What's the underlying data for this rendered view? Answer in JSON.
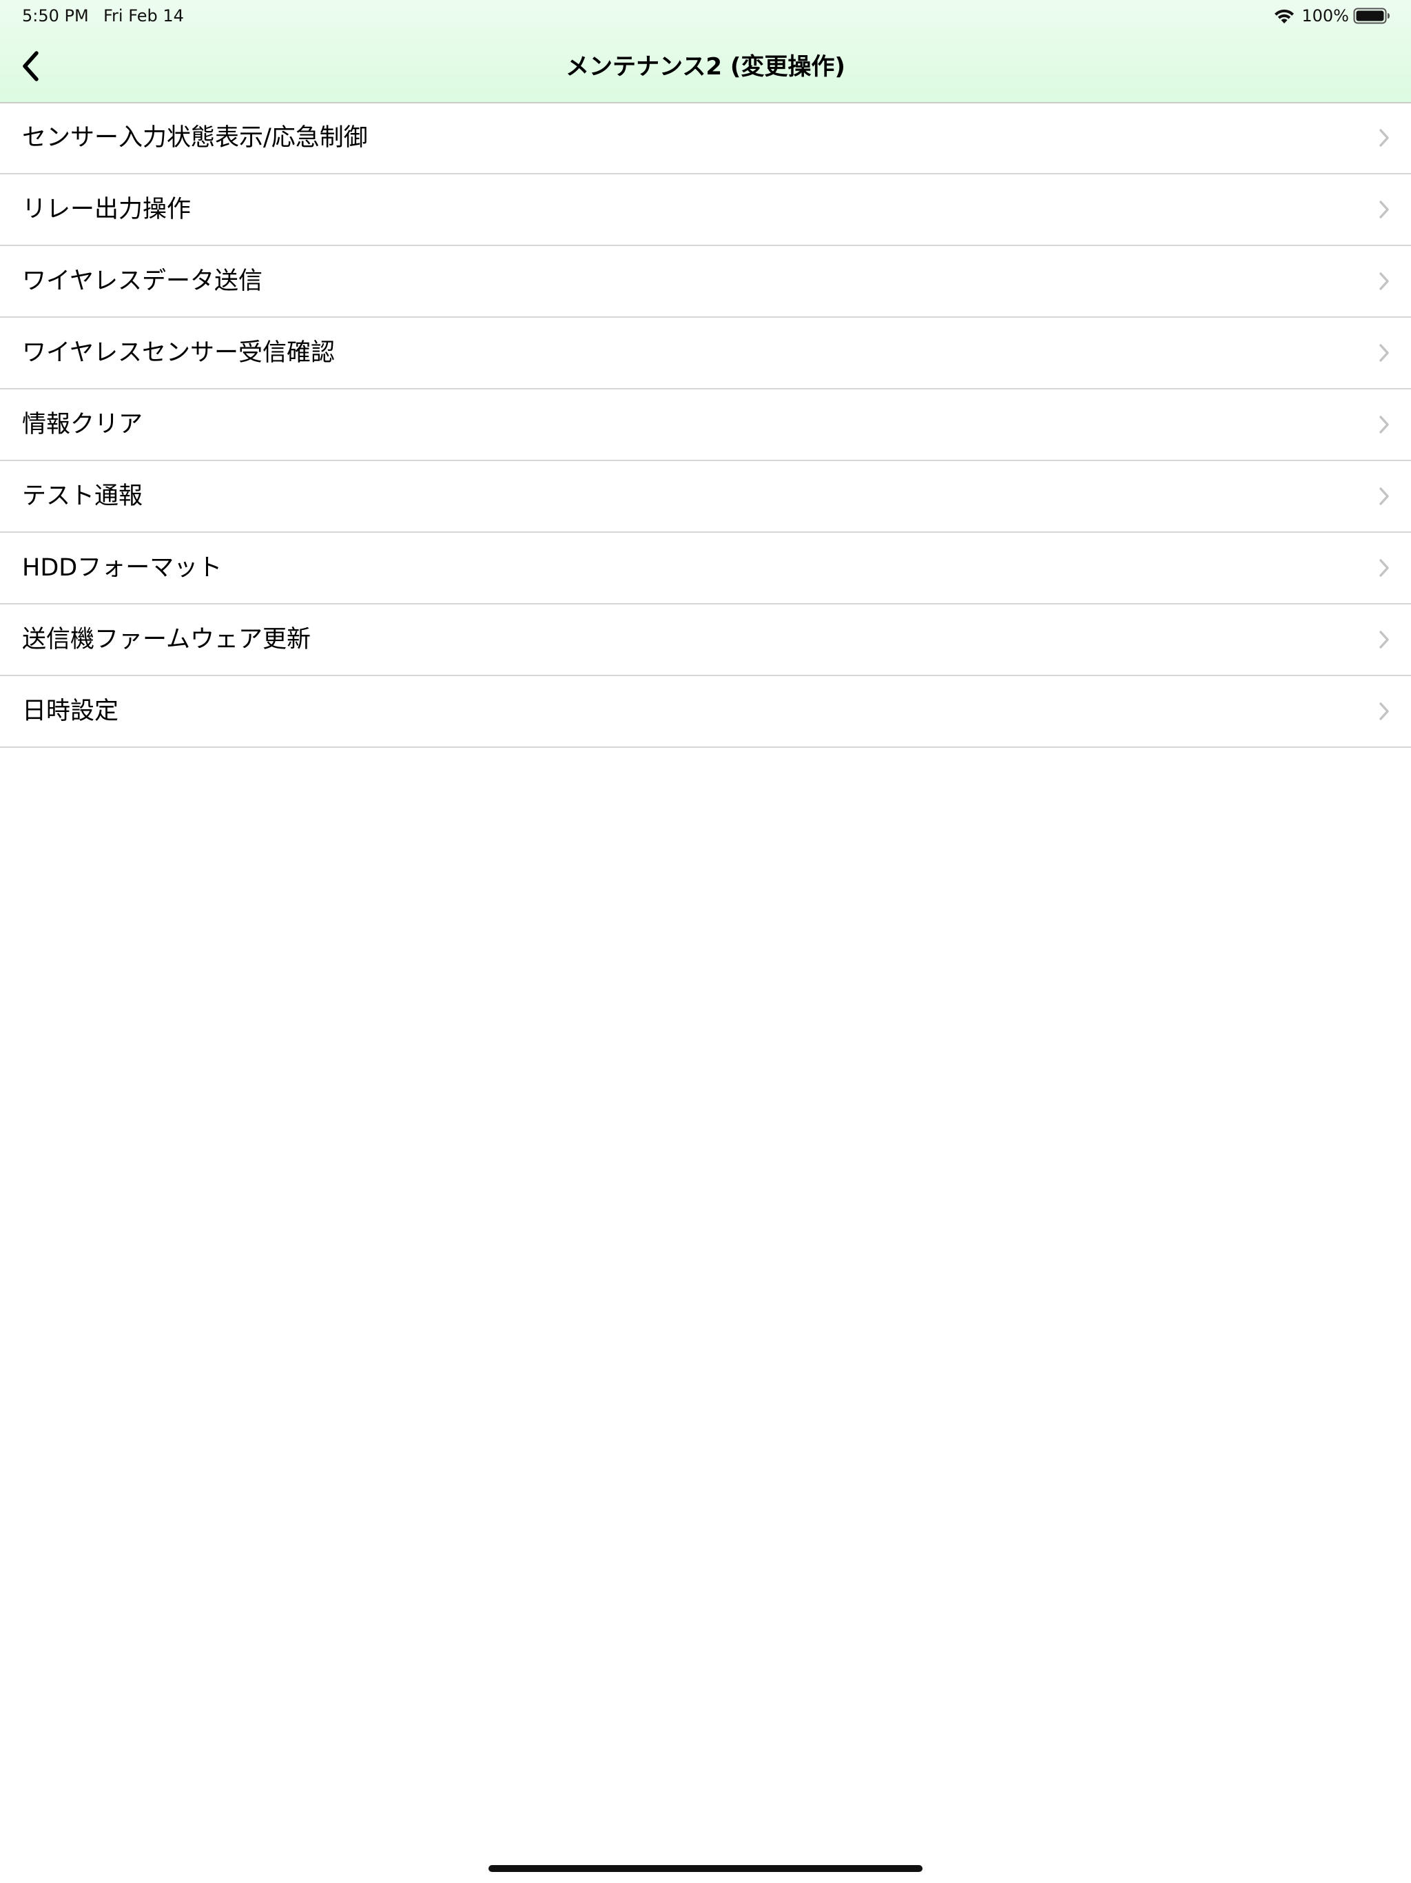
{
  "status_bar": {
    "time": "5:50 PM",
    "date": "Fri Feb 14",
    "battery_percent": "100%",
    "wifi_icon": "wifi-icon",
    "battery_icon": "battery-icon"
  },
  "nav": {
    "title": "メンテナンス2 (変更操作)",
    "back_icon": "chevron-left-icon"
  },
  "menu": {
    "items": [
      {
        "label": "センサー入力状態表示/応急制御"
      },
      {
        "label": "リレー出力操作"
      },
      {
        "label": "ワイヤレスデータ送信"
      },
      {
        "label": "ワイヤレスセンサー受信確認"
      },
      {
        "label": "情報クリア"
      },
      {
        "label": "テスト通報"
      },
      {
        "label": "HDDフォーマット"
      },
      {
        "label": "送信機ファームウェア更新"
      },
      {
        "label": "日時設定"
      }
    ],
    "row_icon": "chevron-right-icon"
  },
  "colors": {
    "header_top": "#edfcef",
    "header_bottom": "#dcfbe1",
    "separator": "#d6d6d6",
    "chevron": "#c4c4c7"
  }
}
